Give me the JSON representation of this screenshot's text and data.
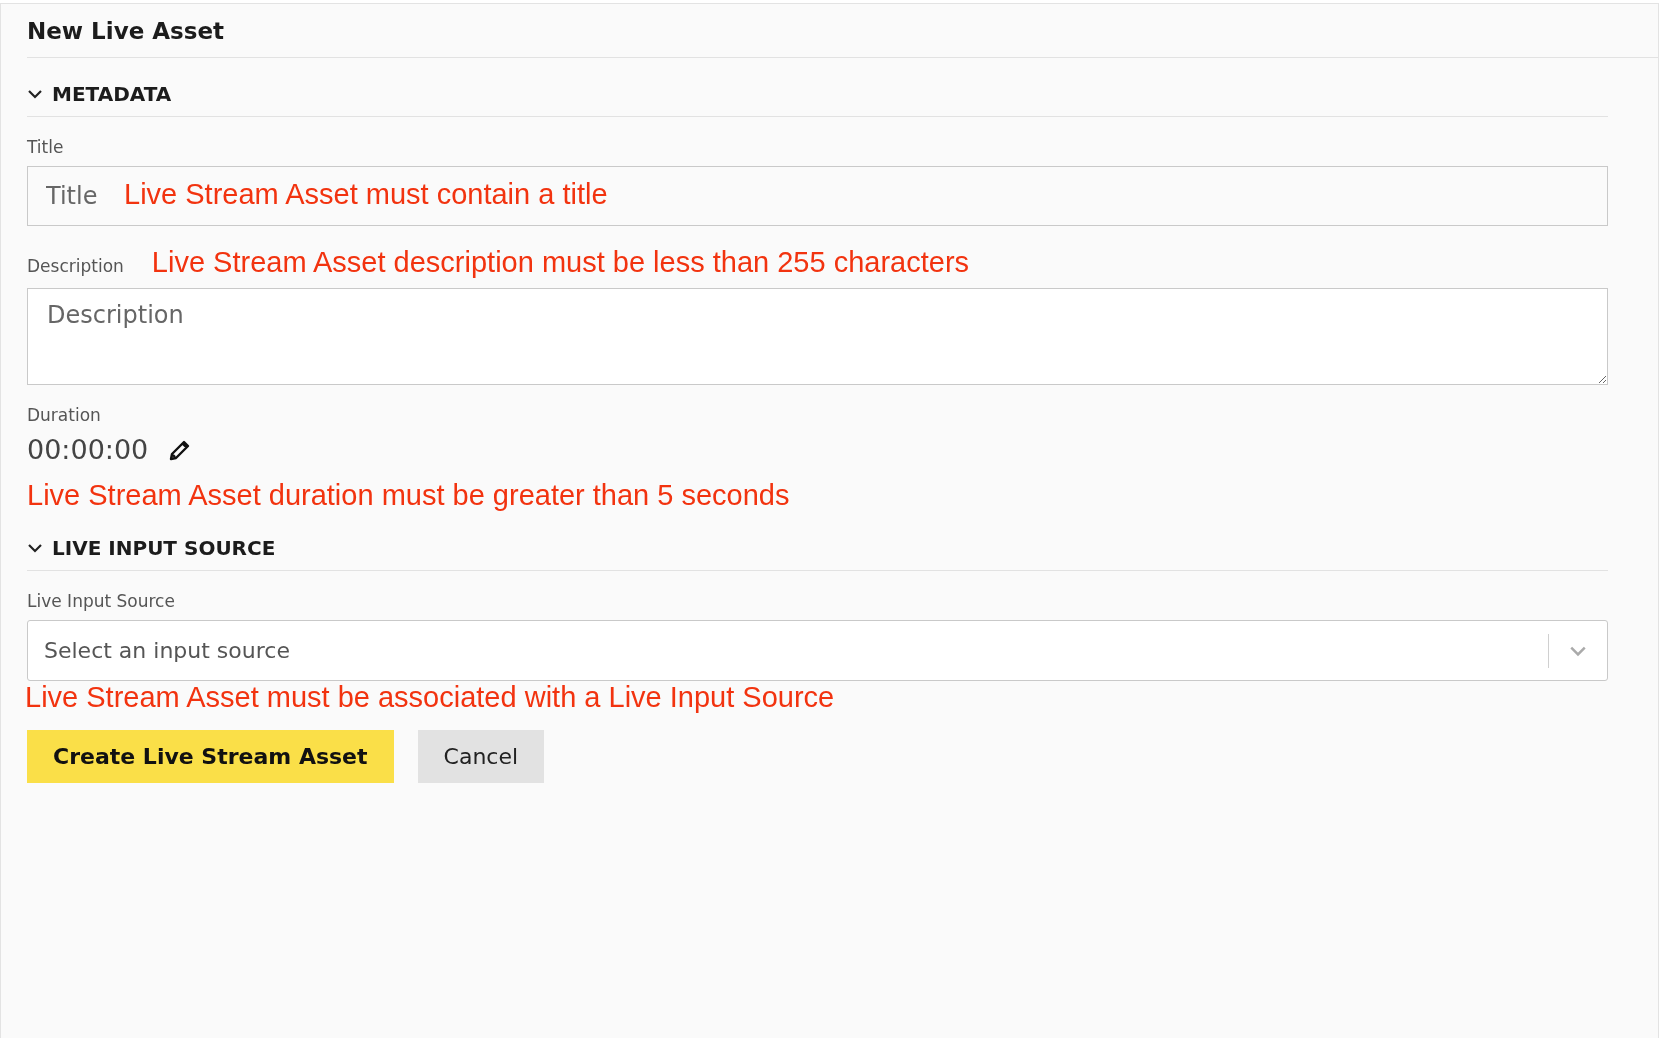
{
  "heading": "New Live Asset",
  "sections": [
    {
      "title": "METADATA",
      "expanded": true,
      "fields": [
        {
          "kind": "text",
          "label": "Title",
          "placeholder": "Title",
          "error": "Live Stream Asset must contain a title"
        },
        {
          "kind": "textarea",
          "label": "Description",
          "placeholder": "Description",
          "error": "Live Stream Asset description must be less than 255 characters"
        },
        {
          "kind": "duration",
          "label": "Duration",
          "value": "00:00:00",
          "error": "Live Stream Asset duration must be greater than 5 seconds"
        }
      ]
    },
    {
      "title": "LIVE INPUT SOURCE",
      "expanded": true,
      "fields": [
        {
          "kind": "select",
          "label": "Live Input Source",
          "placeholder": "Select an input source",
          "error": "Live Stream Asset must be associated with a Live Input Source"
        }
      ]
    }
  ],
  "buttons": [
    {
      "label": "Create Live Stream Asset",
      "kind": "primary"
    },
    {
      "label": "Cancel",
      "kind": "secondary"
    }
  ]
}
